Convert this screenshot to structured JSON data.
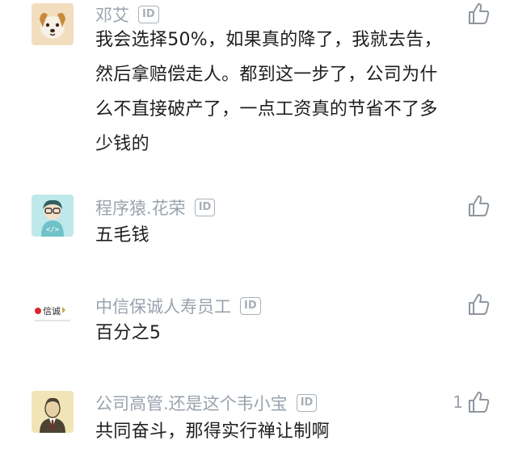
{
  "comments": [
    {
      "username": "邓艾",
      "id_badge": "ID",
      "avatar": "dog-avatar",
      "text": "我会选择50%，如果真的降了，我就去告，然后拿赔偿走人。都到这一步了，公司为什么不直接破产了，一点工资真的节省不了多少钱的",
      "likes": ""
    },
    {
      "username": "程序猿.花荣",
      "id_badge": "ID",
      "avatar": "programmer-avatar",
      "text": "五毛钱",
      "likes": ""
    },
    {
      "username": "中信保诚人寿员工",
      "id_badge": "ID",
      "avatar": "company-logo-avatar",
      "avatar_text": "信诚",
      "text": "百分之5",
      "likes": ""
    },
    {
      "username": "公司高管.还是这个韦小宝",
      "id_badge": "ID",
      "avatar": "executive-avatar",
      "text": "共同奋斗，那得实行禅让制啊",
      "likes": "1"
    }
  ],
  "icons": {
    "like": "thumbs-up-icon",
    "id": "id-badge-icon"
  },
  "colors": {
    "username": "#9aa3ad",
    "text": "#1e1e1e",
    "icon": "#8e969e"
  }
}
